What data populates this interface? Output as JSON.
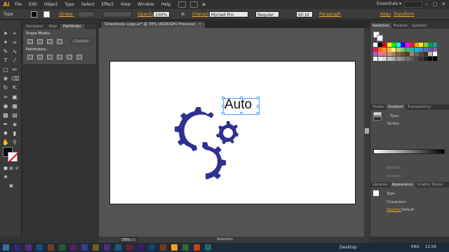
{
  "app": {
    "logo": "Ai",
    "accent": "#f7a01c"
  },
  "menu": [
    "File",
    "Edit",
    "Object",
    "Type",
    "Select",
    "Effect",
    "View",
    "Window",
    "Help"
  ],
  "workspace": "Essentials",
  "control_bar": {
    "type_label": "Type",
    "stroke_label": "Stroke:",
    "opacity_label": "Opacity:",
    "opacity_value": "100%",
    "character_label": "Character",
    "font_family": "Myriad Pro",
    "font_style": "Regular",
    "font_size": "60 pt",
    "paragraph_label": "Paragraph",
    "align_label": "Align",
    "transform_label": "Transform"
  },
  "pathfinder": {
    "tabs": [
      "Navigator",
      "Align",
      "Pathfinder"
    ],
    "shape_modes": "Shape Modes:",
    "pathfinders": "Pathfinders:",
    "expand": "Expand"
  },
  "document": {
    "tab_title": "StreetAuto Logo.ai* @ 78% (RGB/GPU Preview)",
    "zoom": "78%",
    "status": "Selection",
    "artwork_text": "Auto",
    "gear_color": "#2e3192"
  },
  "right_panel": {
    "top_tabs": [
      "Swatches",
      "Brushes",
      "Symbols"
    ],
    "mid_tabs": [
      "Stroke",
      "Gradient",
      "Transparency"
    ],
    "gradient_type": "Type:",
    "gradient_stroke": "Stroke:",
    "opacity_label": "Opacity:",
    "location_label": "Location:",
    "bottom_tabs": [
      "Libraries",
      "Appearance",
      "Graphic Styles"
    ],
    "appearance_type": "Type",
    "appearance_characters": "Characters",
    "appearance_opacity": "Opacity:",
    "appearance_opacity_value": "Default"
  },
  "taskbar": {
    "desktop": "Desktop",
    "lang": "ENG",
    "time": "12:58"
  },
  "swatch_colors": [
    "#ffffff",
    "#000000",
    "#ff0000",
    "#ffff00",
    "#00ff00",
    "#00ffff",
    "#0000ff",
    "#ff00ff",
    "#ed1c24",
    "#f7941d",
    "#fff200",
    "#8dc63f",
    "#00a651",
    "#00a99d",
    "#ed145b",
    "#f26522",
    "#f7941d",
    "#fbaf5d",
    "#fff568",
    "#acd372",
    "#7cc576",
    "#3bb878",
    "#1abbb4",
    "#00bff3",
    "#438ccb",
    "#5674b9",
    "#605ca8",
    "#855fa8",
    "#a763a8",
    "#f06ea9",
    "#f26d7d",
    "#c69c6d",
    "#a67c52",
    "#8c6239",
    "#754c24",
    "#603913",
    "#998675",
    "#736357",
    "#534741",
    "#362f2d",
    "#c7b299",
    "#ffffff",
    "#ffffff",
    "#ebebeb",
    "#d6d6d6",
    "#c2c2c2",
    "#adadad",
    "#999999",
    "#858585",
    "#707070",
    "#5c5c5c",
    "#474747",
    "#333333",
    "#1f1f1f",
    "#0a0a0a",
    "#000000"
  ]
}
